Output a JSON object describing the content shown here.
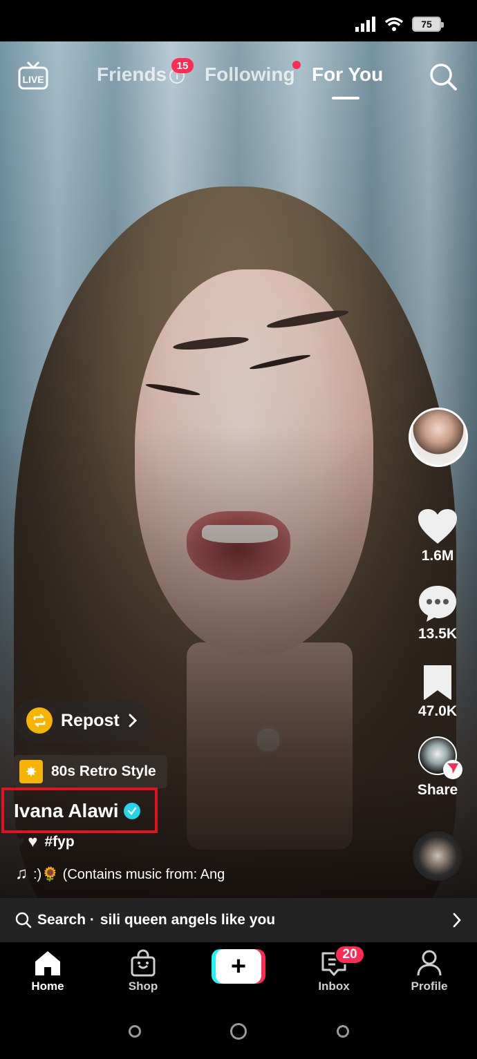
{
  "status_bar": {
    "battery": "75"
  },
  "top_nav": {
    "live_label": "LIVE",
    "tabs": [
      {
        "label": "Friends",
        "badge": "15"
      },
      {
        "label": "Following"
      },
      {
        "label": "For You",
        "active": true
      }
    ]
  },
  "actions": {
    "likes": "1.6M",
    "comments": "13.5K",
    "saves": "47.0K",
    "share": "Share"
  },
  "overlay": {
    "repost": "Repost",
    "effect": "80s Retro Style",
    "username": "Ivana Alawi",
    "caption_hashtag": "#fyp",
    "music": ":)🌻 (Contains music from: Ang"
  },
  "search_bar": {
    "prefix": "Search ·",
    "query": "sili queen angels like you"
  },
  "bottom_nav": {
    "home": "Home",
    "shop": "Shop",
    "inbox": "Inbox",
    "inbox_badge": "20",
    "profile": "Profile"
  },
  "colors": {
    "accent": "#fe2c55",
    "cyan": "#25f4ee",
    "highlight_box": "#e0141e",
    "verified": "#20d5ec",
    "repost": "#f5b400"
  }
}
